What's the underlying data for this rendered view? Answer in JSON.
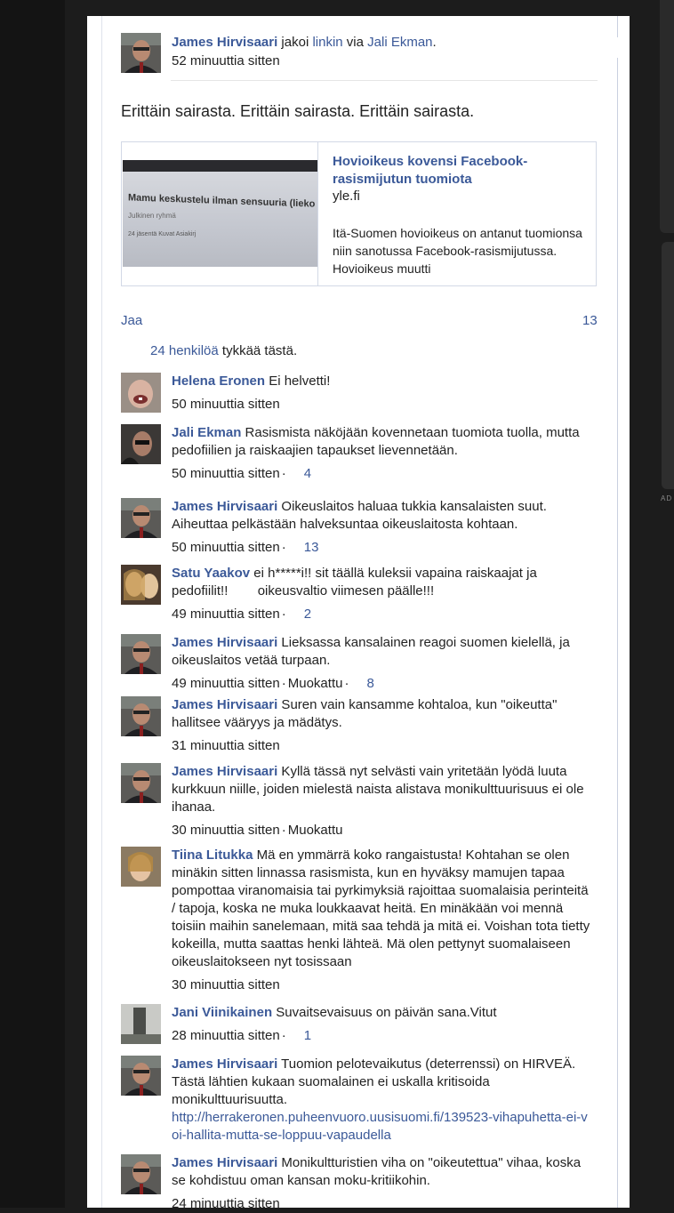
{
  "post": {
    "author": "James Hirvisaari",
    "action_text": " jakoi ",
    "link_word": "linkin",
    "via_text": " via ",
    "via_name": "Jali Ekman",
    "period": ".",
    "time": "52 minuuttia sitten",
    "text": "Erittäin sairasta. Erittäin sairasta. Erittäin sairasta."
  },
  "shared_link": {
    "title": "Hovioikeus kovensi Facebook-rasismijutun tuomiota",
    "domain": "yle.fi",
    "description": "Itä-Suomen hovioikeus on antanut tuomionsa niin sanotussa Facebook-rasismijutussa. Hovioikeus muutti",
    "thumbnail": {
      "title": "Mamu keskustelu ilman sensuuria (lieko",
      "subtitle": "Julkinen ryhmä",
      "meta": "24 jäsentä   Kuvat   Asiakirj"
    }
  },
  "actions": {
    "share_label": "Jaa",
    "share_count": "13",
    "likes_link": "24 henkilöä",
    "likes_text": " tykkää tästä."
  },
  "comments": [
    {
      "name": "Helena Eronen",
      "text": " Ei helvetti!",
      "time": "50 minuuttia sitten",
      "edited": "",
      "likes": ""
    },
    {
      "name": "Jali Ekman",
      "text": " Rasismista näköjään kovennetaan tuomiota tuolla, mutta pedofiilien ja raiskaajien tapaukset lievennetään.",
      "time": "50 minuuttia sitten",
      "edited": "",
      "likes": "4"
    },
    {
      "name": "James Hirvisaari",
      "text": " Oikeuslaitos haluaa tukkia kansalaisten suut. Aiheuttaa pelkästään halveksuntaa oikeuslaitosta kohtaan.",
      "time": "50 minuuttia sitten",
      "edited": "",
      "likes": "13"
    },
    {
      "name": "Satu Yaakov",
      "text": " ei h*****i!! sit täällä kuleksii vapaina raiskaajat ja pedofiilit!!        oikeusvaltio viimesen päälle!!!",
      "time": "49 minuuttia sitten",
      "edited": "",
      "likes": "2"
    },
    {
      "name": "James Hirvisaari",
      "text": " Lieksassa kansalainen reagoi suomen kielellä, ja oikeuslaitos vetää turpaan.",
      "time": "49 minuuttia sitten",
      "edited": "Muokattu",
      "likes": "8"
    },
    {
      "name": "James Hirvisaari",
      "text": " Suren vain kansamme kohtaloa, kun \"oikeutta\" hallitsee vääryys ja mädätys.",
      "time": "31 minuuttia sitten",
      "edited": "",
      "likes": ""
    },
    {
      "name": "James Hirvisaari",
      "text": " Kyllä tässä nyt selvästi vain yritetään lyödä luuta kurkkuun niille, joiden mielestä naista alistava monikulttuurisuus ei ole ihanaa.",
      "time": "30 minuuttia sitten",
      "edited": "Muokattu",
      "likes": ""
    },
    {
      "name": "Tiina Litukka",
      "text": " Mä en ymmärrä koko rangaistusta! Kohtahan se olen minäkin sitten linnassa rasismista, kun en hyväksy mamujen tapaa pompottaa viranomaisia tai pyrkimyksiä rajoittaa suomalaisia perinteitä / tapoja, koska ne muka loukkaavat heitä. En minäkään voi mennä toisiin maihin sanelemaan, mitä saa tehdä ja mitä ei. Voishan tota tietty kokeilla, mutta saattas henki lähteä. Mä olen pettynyt suomalaiseen oikeuslaitokseen nyt tosissaan",
      "time": "30 minuuttia sitten",
      "edited": "",
      "likes": ""
    },
    {
      "name": "Jani Viinikainen",
      "text": " Suvaitsevaisuus on päivän sana.Vitut",
      "time": "28 minuuttia sitten",
      "edited": "",
      "likes": "1"
    },
    {
      "name": "James Hirvisaari",
      "text": " Tuomion pelotevaikutus (deterrenssi) on HIRVEÄ. Tästä lähtien kukaan suomalainen ei uskalla kritisoida monikulttuurisuutta.",
      "link": "http://herrakeronen.puheenvuoro.uusisuomi.fi/139523-vihapuhetta-ei-voi-hallita-mutta-se-loppuu-vapaudella",
      "time": "",
      "edited": "",
      "likes": ""
    },
    {
      "name": "James Hirvisaari",
      "text": " Monikultturistien viha on \"oikeutettua\" vihaa, koska se kohdistuu oman kansan moku-kritiikohin.",
      "time": "24 minuuttia sitten",
      "edited": "",
      "likes": ""
    }
  ],
  "ui": {
    "side_label": "AD",
    "meta_dot": "·"
  }
}
